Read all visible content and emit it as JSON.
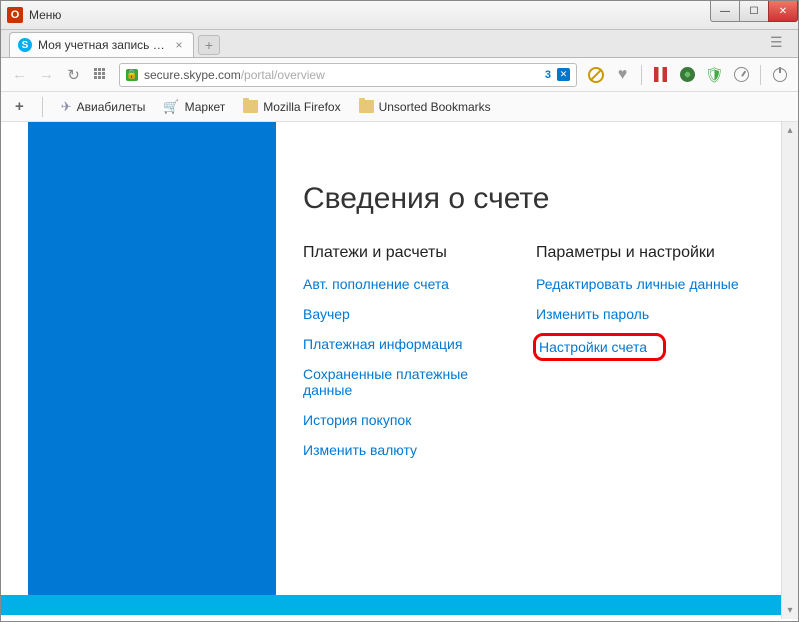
{
  "window": {
    "menu": "Меню"
  },
  "tab": {
    "title": "Моя учетная запись Skyp"
  },
  "address": {
    "host": "secure.skype.com",
    "path": "/portal/overview",
    "badge": "3"
  },
  "bookmarks": {
    "items": [
      {
        "label": "Авиабилеты"
      },
      {
        "label": "Маркет"
      },
      {
        "label": "Mozilla Firefox"
      },
      {
        "label": "Unsorted Bookmarks"
      }
    ]
  },
  "page": {
    "heading": "Сведения о счете",
    "col1": {
      "title": "Платежи и расчеты",
      "links": [
        "Авт. пополнение счета",
        "Ваучер",
        "Платежная информация",
        "Сохраненные платежные данные",
        "История покупок",
        "Изменить валюту"
      ]
    },
    "col2": {
      "title": "Параметры и настройки",
      "links": [
        "Редактировать личные данные",
        "Изменить пароль",
        "Настройки счета"
      ]
    }
  }
}
